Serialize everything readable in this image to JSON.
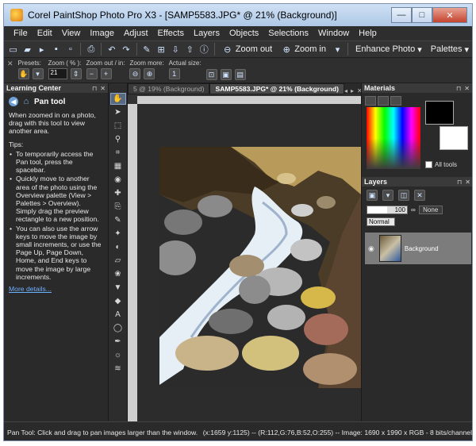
{
  "window": {
    "title": "Corel PaintShop Photo Pro X3 - [SAMP5583.JPG* @  21% (Background)]",
    "buttons": {
      "minimize": "—",
      "maximize": "□",
      "close": "✕"
    }
  },
  "menu": [
    "File",
    "Edit",
    "View",
    "Image",
    "Adjust",
    "Effects",
    "Layers",
    "Objects",
    "Selections",
    "Window",
    "Help"
  ],
  "toolbar": {
    "zoom_out_label": "Zoom out",
    "zoom_in_label": "Zoom in",
    "enhance_photo_label": "Enhance Photo",
    "palettes_label": "Palettes"
  },
  "tool_options": {
    "presets_label": "Presets:",
    "zoom_pct_label": "Zoom ( % ):",
    "zoom_value": "21",
    "zoom_out_in_label": "Zoom out / in:",
    "zoom_more_label": "Zoom more:",
    "actual_size_label": "Actual size:"
  },
  "learning_center": {
    "panel_title": "Learning Center",
    "topic_title": "Pan tool",
    "intro": "When zoomed in on a photo, drag with this tool to view another area.",
    "tips_label": "Tips:",
    "tips": [
      "To temporarily access the Pan tool, press the spacebar.",
      "Quickly move to another area of the photo using the Overview palette (View > Palettes > Overview). Simply drag the preview rectangle to a new position.",
      "You can also use the arrow keys to move the image by small increments, or use the Page Up, Page Down, Home, and End keys to move the image by large increments."
    ],
    "more_details": "More details..."
  },
  "document": {
    "tab_inactive": "5 @  19% (Background)",
    "tab_active": "SAMP5583.JPG* @  21% (Background)"
  },
  "materials": {
    "panel_title": "Materials",
    "all_tools_label": "All tools"
  },
  "layers": {
    "panel_title": "Layers",
    "opacity": "100",
    "blend_mode": "Normal",
    "mask_value": "None",
    "layer_name": "Background"
  },
  "status": {
    "hint": "Pan Tool: Click and drag to pan images larger than the window.",
    "info": "(x:1659 y:1125) -- (R:112,G:76,B:52,O:255) -- Image:  1690 x 1990 x RGB - 8 bits/channel"
  }
}
